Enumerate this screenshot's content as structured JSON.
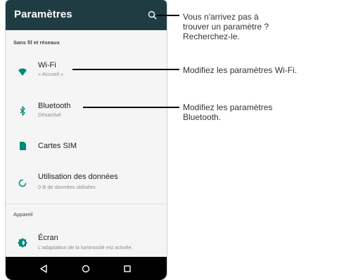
{
  "app": {
    "title": "Paramètres"
  },
  "sections": {
    "wireless": "Sans fil et réseaux",
    "device": "Appareil"
  },
  "items": {
    "wifi": {
      "title": "Wi-Fi",
      "subtitle": "« Accueil »",
      "icon": "wifi-icon"
    },
    "bluetooth": {
      "title": "Bluetooth",
      "subtitle": "Désactivé",
      "icon": "bluetooth-icon"
    },
    "sim": {
      "title": "Cartes SIM",
      "icon": "sim-card-icon"
    },
    "data_usage": {
      "title": "Utilisation des données",
      "subtitle": "0 B de données utilisées",
      "icon": "data-usage-icon"
    },
    "display": {
      "title": "Écran",
      "subtitle": "L'adaptation de la luminosité est activée.",
      "icon": "brightness-icon"
    }
  },
  "navbar": {
    "icons": [
      "back-icon",
      "home-icon",
      "recents-icon"
    ]
  },
  "callouts": {
    "search": [
      "Vous n'arrivez pas à",
      "trouver un paramètre ?",
      "Recherchez-le."
    ],
    "wifi": [
      "Modifiez les paramètres Wi-Fi."
    ],
    "bluetooth": [
      "Modifiez les paramètres",
      "Bluetooth."
    ]
  },
  "colors": {
    "appbar": "#1f3c43",
    "accent": "#00897b",
    "navbar": "#000000"
  }
}
